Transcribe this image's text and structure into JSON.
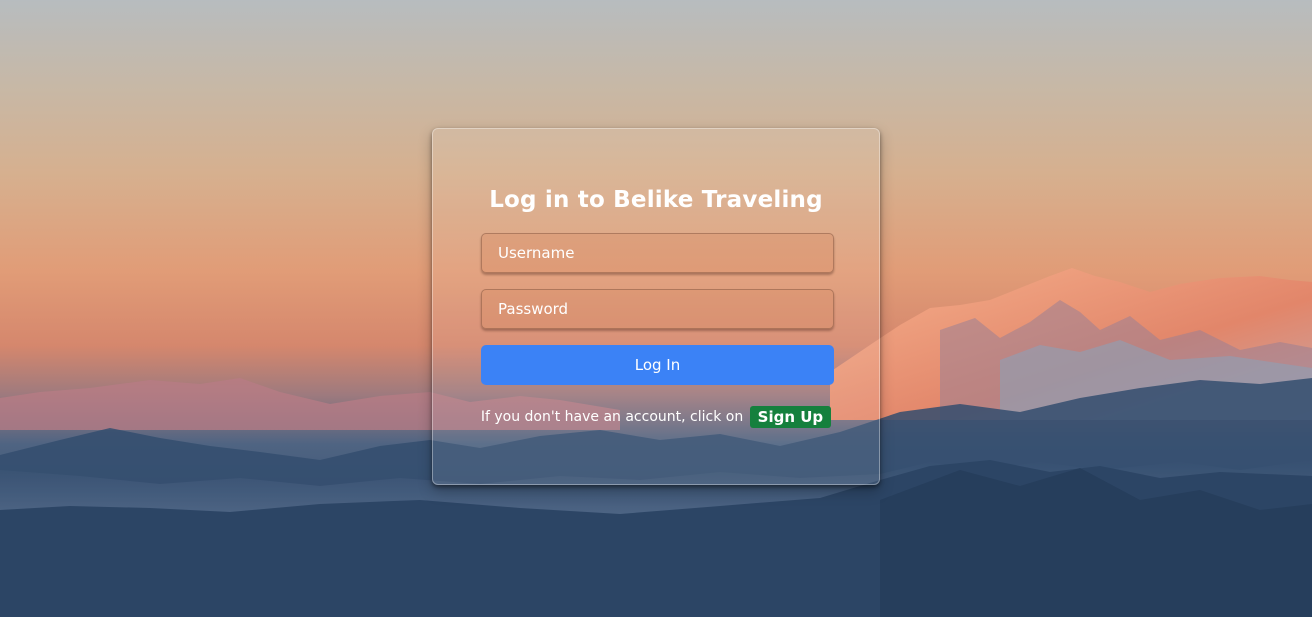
{
  "page": {
    "title": "Log in to Belike Traveling"
  },
  "form": {
    "username_placeholder": "Username",
    "password_placeholder": "Password",
    "login_label": "Log In",
    "signup_prompt": "If you don't have an account, click on",
    "signup_label": "Sign Up"
  },
  "colors": {
    "login_button": "#3b82f6",
    "signup_button": "#15803d",
    "text": "#ffffff"
  }
}
